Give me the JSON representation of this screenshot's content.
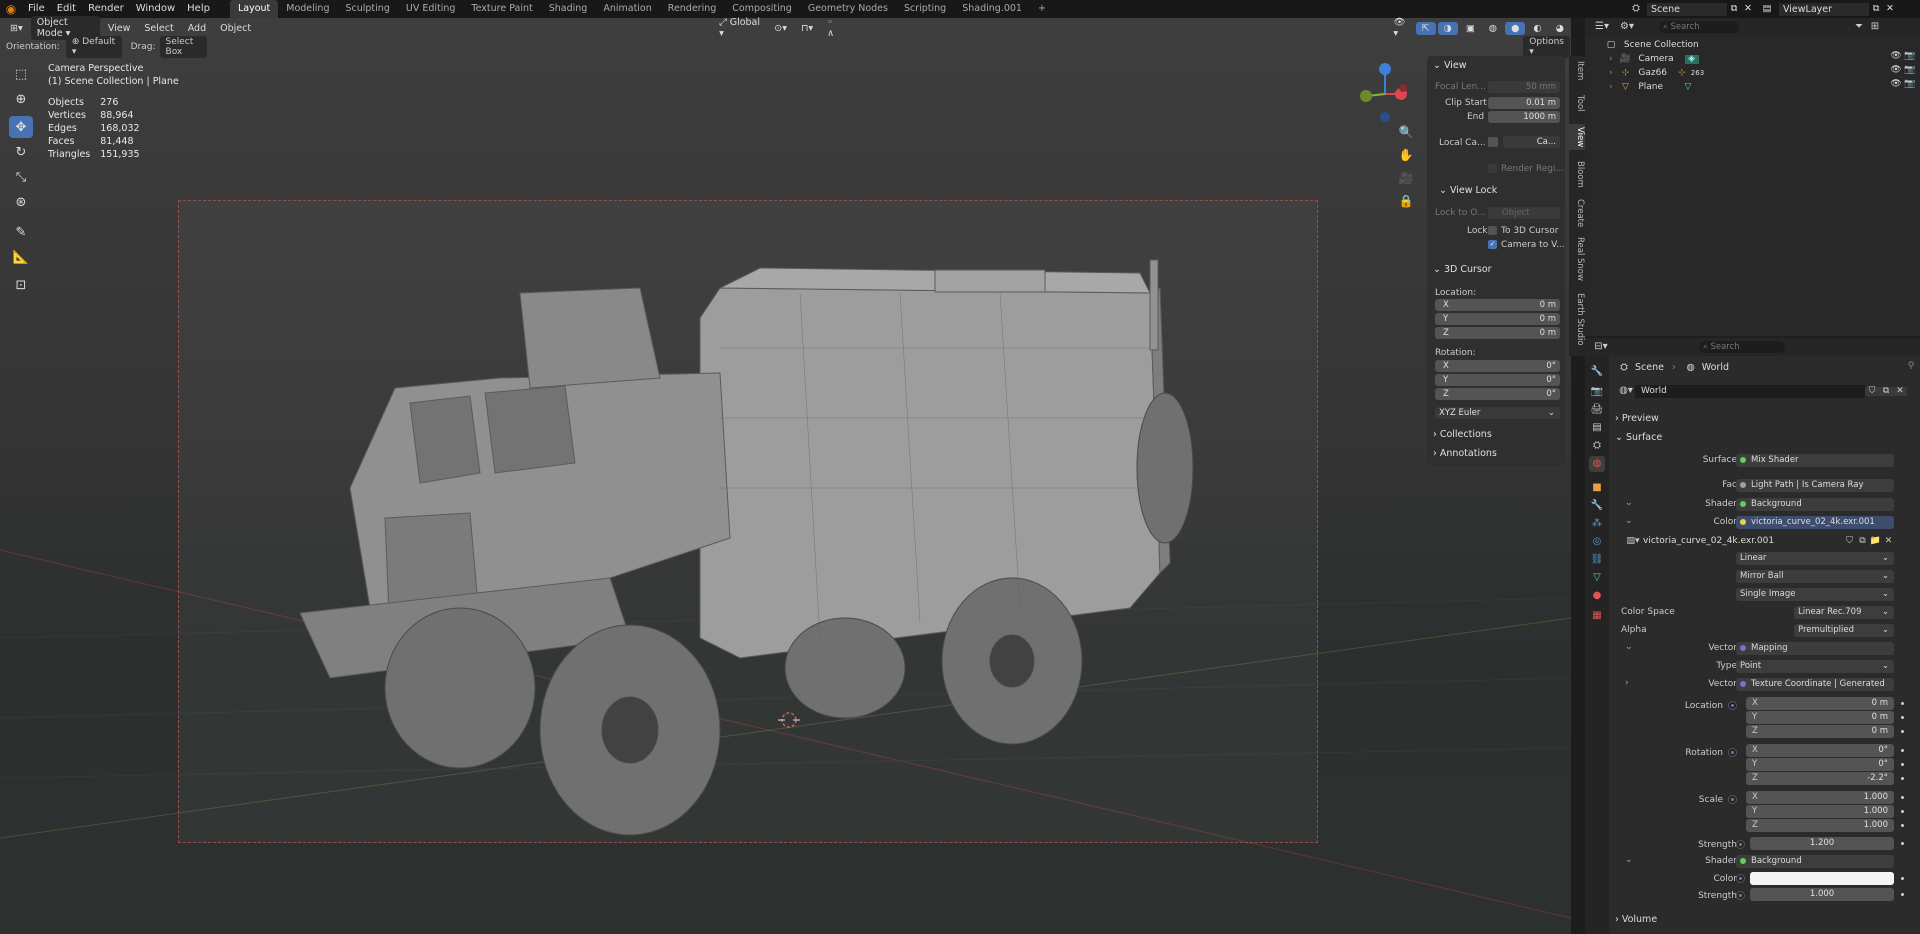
{
  "topbar": {
    "menus": [
      "File",
      "Edit",
      "Render",
      "Window",
      "Help"
    ],
    "workspaces": [
      "Layout",
      "Modeling",
      "Sculpting",
      "UV Editing",
      "Texture Paint",
      "Shading",
      "Animation",
      "Rendering",
      "Compositing",
      "Geometry Nodes",
      "Scripting",
      "Shading.001"
    ],
    "active_workspace": "Layout",
    "add_tab": "+",
    "scene_name": "Scene",
    "view_layer": "ViewLayer"
  },
  "viewport_header": {
    "mode": "Object Mode",
    "menus": [
      "View",
      "Select",
      "Add",
      "Object"
    ],
    "transform_orientation": "Global",
    "orientation_label": "Orientation:",
    "orientation_value": "Default",
    "drag_label": "Drag:",
    "drag_value": "Select Box",
    "options": "Options"
  },
  "overlay_stats": {
    "view_name": "Camera Perspective",
    "collection": "(1) Scene Collection | Plane",
    "rows": [
      {
        "label": "Objects",
        "value": "276"
      },
      {
        "label": "Vertices",
        "value": "88,964"
      },
      {
        "label": "Edges",
        "value": "168,032"
      },
      {
        "label": "Faces",
        "value": "81,448"
      },
      {
        "label": "Triangles",
        "value": "151,935"
      }
    ]
  },
  "npanel": {
    "view_title": "View",
    "focal_label": "Focal Len...",
    "focal_value": "50 mm",
    "clip_start_label": "Clip Start",
    "clip_start_value": "0.01 m",
    "clip_end_label": "End",
    "clip_end_value": "1000 m",
    "local_cam_label": "Local Ca...",
    "local_cam_value": "Ca...",
    "render_region": "Render Regi...",
    "view_lock_title": "View Lock",
    "lock_to_label": "Lock to O...",
    "lock_to_value": "Object",
    "lock_label": "Lock",
    "to_3d_cursor": "To 3D Cursor",
    "camera_to_view": "Camera to V...",
    "cursor_title": "3D Cursor",
    "location_label": "Location:",
    "loc": [
      {
        "axis": "X",
        "value": "0 m"
      },
      {
        "axis": "Y",
        "value": "0 m"
      },
      {
        "axis": "Z",
        "value": "0 m"
      }
    ],
    "rotation_label": "Rotation:",
    "rot": [
      {
        "axis": "X",
        "value": "0°"
      },
      {
        "axis": "Y",
        "value": "0°"
      },
      {
        "axis": "Z",
        "value": "0°"
      }
    ],
    "rot_mode": "XYZ Euler",
    "collections": "Collections",
    "annotations": "Annotations",
    "tabs": [
      "Item",
      "Tool",
      "View",
      "Bloom",
      "Create",
      "Real Snow",
      "Earth Studio"
    ],
    "active_tab": "View"
  },
  "outliner": {
    "search_placeholder": "Search",
    "root": "Scene Collection",
    "items": [
      {
        "name": "Camera",
        "extra": ""
      },
      {
        "name": "Gaz66",
        "extra": "263"
      },
      {
        "name": "Plane",
        "extra": ""
      }
    ]
  },
  "properties": {
    "search_placeholder": "Search",
    "breadcrumb_scene": "Scene",
    "breadcrumb_world": "World",
    "world_name": "World",
    "preview": "Preview",
    "surface": "Surface",
    "rows": {
      "surface_label": "Surface",
      "surface_value": "Mix Shader",
      "fac_label": "Fac",
      "fac_value": "Light Path | Is Camera Ray",
      "shader1_label": "Shader",
      "shader1_value": "Background",
      "color1_label": "Color",
      "color1_value": "victoria_curve_02_4k.exr.001",
      "image_name": "victoria_curve_02_4k.exr.001",
      "interp": "Linear",
      "projection": "Mirror Ball",
      "source": "Single Image",
      "colorspace_label": "Color Space",
      "colorspace_value": "Linear Rec.709",
      "alpha_label": "Alpha",
      "alpha_value": "Premultiplied",
      "vector1_label": "Vector",
      "vector1_value": "Mapping",
      "type_label": "Type",
      "type_value": "Point",
      "vector2_label": "Vector",
      "vector2_value": "Texture Coordinate | Generated",
      "location_label": "Location",
      "rotation_label": "Rotation",
      "scale_label": "Scale",
      "strength1_label": "Strength",
      "strength1_value": "1.200",
      "shader2_label": "Shader",
      "shader2_value": "Background",
      "color2_label": "Color",
      "strength2_label": "Strength",
      "strength2_value": "1.000",
      "volume": "Volume"
    },
    "location": [
      {
        "axis": "X",
        "value": "0 m"
      },
      {
        "axis": "Y",
        "value": "0 m"
      },
      {
        "axis": "Z",
        "value": "0 m"
      }
    ],
    "rotation": [
      {
        "axis": "X",
        "value": "0°"
      },
      {
        "axis": "Y",
        "value": "0°"
      },
      {
        "axis": "Z",
        "value": "-2.2°"
      }
    ],
    "scale": [
      {
        "axis": "X",
        "value": "1.000"
      },
      {
        "axis": "Y",
        "value": "1.000"
      },
      {
        "axis": "Z",
        "value": "1.000"
      }
    ]
  },
  "colors": {
    "accent": "#4772b3",
    "header_bg": "#181818",
    "panel_bg": "#2b2b2b",
    "gizmo_x": "#e0454f",
    "gizmo_y": "#8bb23b",
    "gizmo_z": "#3f7fd6"
  }
}
